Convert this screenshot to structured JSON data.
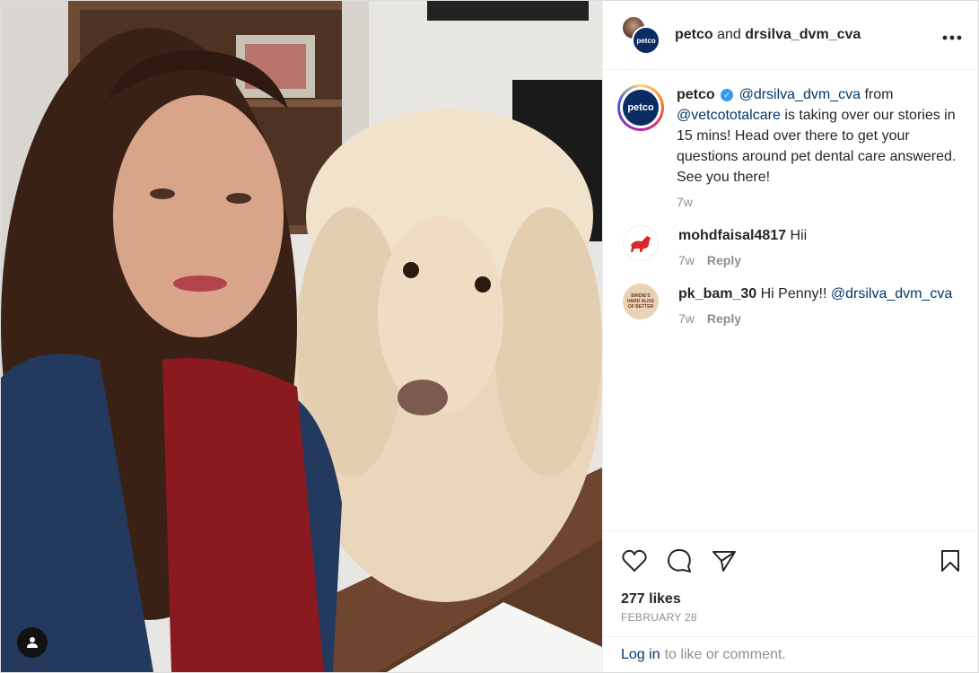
{
  "header": {
    "account": "petco",
    "joiner": "and",
    "collaborator": "drsilva_dvm_cva",
    "avatar_text": "petco",
    "more_icon": "more-horizontal-icon"
  },
  "caption": {
    "username": "petco",
    "avatar_text": "petco",
    "verified_glyph": "✓",
    "mention_1": "@drsilva_dvm_cva",
    "text_1": "from",
    "mention_2": "@vetcototalcare",
    "text_2": "is taking over our stories in 15 mins! Head over there to get your questions around pet dental care answered. See you there!",
    "time": "7w"
  },
  "comments": [
    {
      "username": "mohdfaisal4817",
      "text": "Hii",
      "time": "7w",
      "reply_label": "Reply"
    },
    {
      "username": "pk_bam_30",
      "text": "Hi Penny!!",
      "mention": "@drsilva_dvm_cva",
      "time": "7w",
      "reply_label": "Reply",
      "avatar_text": "BIRDIE'S HARD ALIVE OF BETTER"
    }
  ],
  "actions": {
    "like_icon": "heart-icon",
    "comment_icon": "comment-icon",
    "share_icon": "share-icon",
    "save_icon": "bookmark-icon"
  },
  "likes": "277 likes",
  "date": "FEBRUARY 28",
  "login": {
    "link": "Log in",
    "text": "to like or comment."
  },
  "colors": {
    "link": "#00376b",
    "muted": "#8e8e8e",
    "petco_blue": "#0d2b63"
  }
}
